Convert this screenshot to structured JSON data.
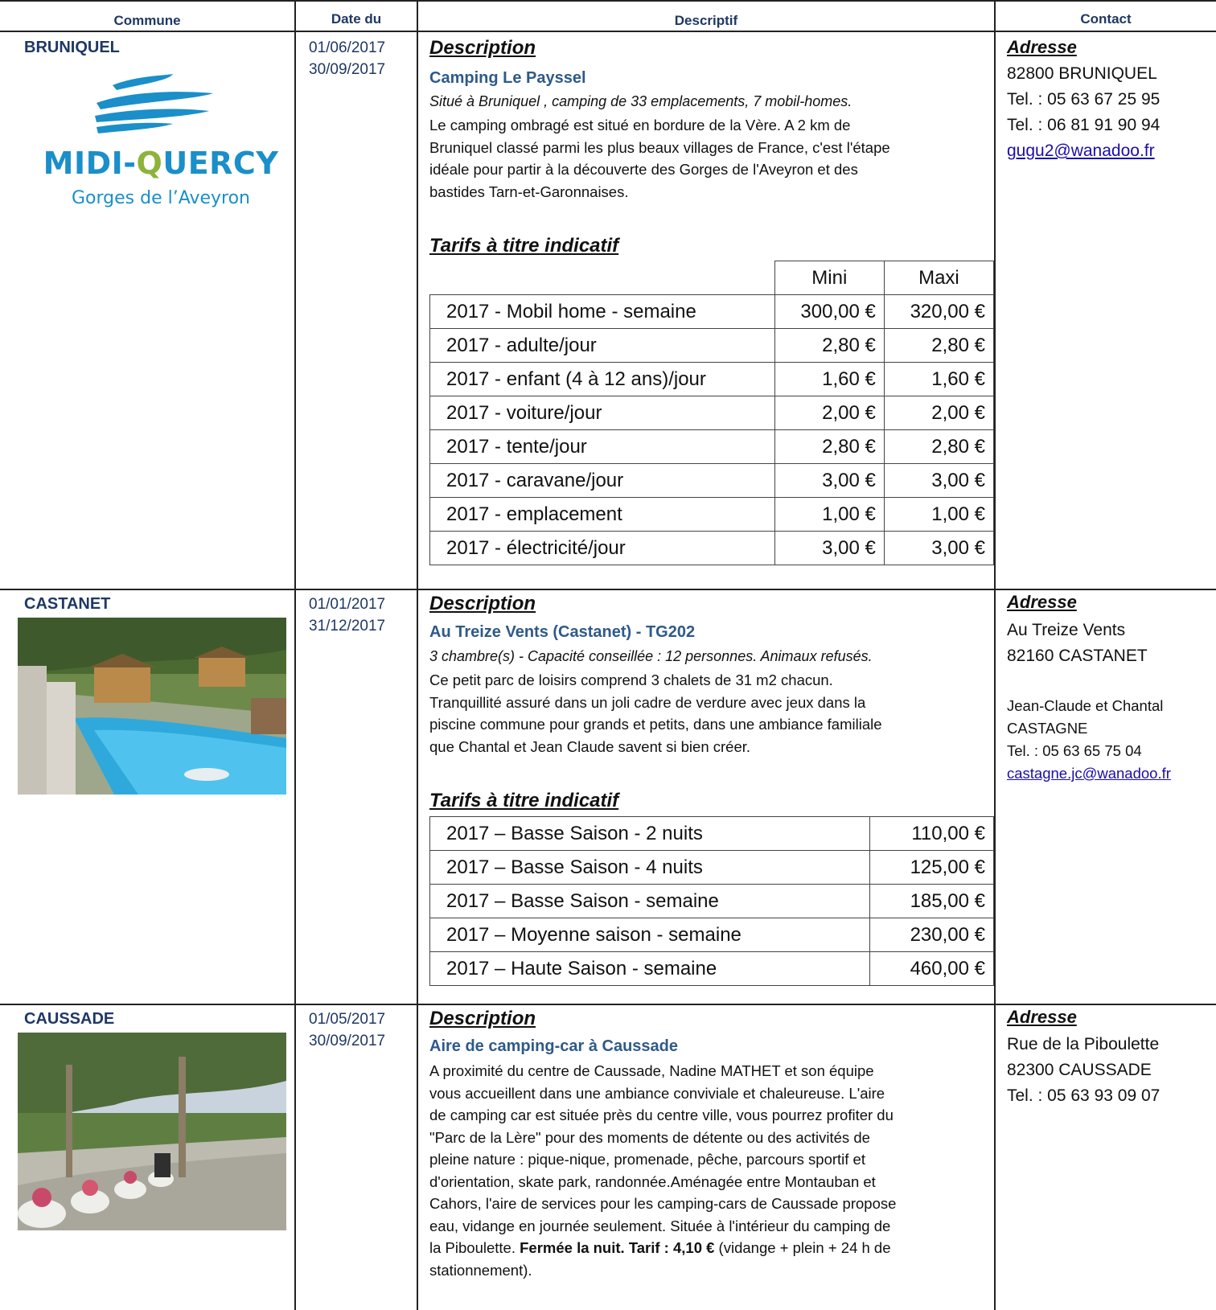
{
  "headers": {
    "commune": "Commune",
    "date": "Date du",
    "descriptif": "Descriptif",
    "contact": "Contact"
  },
  "rows": [
    {
      "commune": "BRUNIQUEL",
      "logo": {
        "line1": "MIDI-QUERCY",
        "line2": "Gorges de l’Aveyron",
        "q_color": "#8db33a",
        "brand_color": "#1a8fc9"
      },
      "dates": [
        "01/06/2017",
        "30/09/2017"
      ],
      "desc_heading": "Description",
      "name": "Camping Le Payssel",
      "italic": "Situé à Bruniquel , camping de 33 emplacements,  7 mobil-homes.",
      "lines": [
        "Le camping ombragé est situé en bordure de la Vère. A 2 km de",
        "Bruniquel classé parmi les plus beaux villages de France, c'est l'étape",
        "idéale pour partir à la découverte des Gorges de l'Aveyron et des",
        "bastides Tarn-et-Garonnaises."
      ],
      "tarifs_heading": "Tarifs à titre indicatif",
      "cols": [
        "Mini",
        "Maxi"
      ],
      "prices": [
        [
          "2017 - Mobil home - semaine",
          "300,00 €",
          "320,00 €"
        ],
        [
          "2017 - adulte/jour",
          "2,80 €",
          "2,80 €"
        ],
        [
          "2017 - enfant (4 à 12 ans)/jour",
          "1,60 €",
          "1,60 €"
        ],
        [
          "2017 - voiture/jour",
          "2,00 €",
          "2,00 €"
        ],
        [
          "2017 - tente/jour",
          "2,80 €",
          "2,80 €"
        ],
        [
          "2017 - caravane/jour",
          "3,00 €",
          "3,00 €"
        ],
        [
          "2017 - emplacement",
          "1,00 €",
          "1,00 €"
        ],
        [
          "2017 - électricité/jour",
          "3,00 €",
          "3,00 €"
        ]
      ],
      "contact_heading": "Adresse",
      "contact": [
        "82800 BRUNIQUEL",
        "Tel. : 05 63 67 25 95",
        "Tel. : 06 81 91 90 94"
      ],
      "email": "gugu2@wanadoo.fr"
    },
    {
      "commune": "CASTANET",
      "dates": [
        "01/01/2017",
        "31/12/2017"
      ],
      "desc_heading": "Description",
      "name": "Au Treize Vents (Castanet) - TG202",
      "italic": "3 chambre(s) - Capacité conseillée : 12 personnes.  Animaux refusés.",
      "lines": [
        "Ce petit parc de loisirs comprend 3 chalets de 31 m2 chacun.",
        "Tranquillité assuré dans un joli cadre de verdure avec jeux dans la",
        "piscine commune pour grands et petits, dans une ambiance familiale",
        "que Chantal et Jean Claude savent si bien créer."
      ],
      "tarifs_heading": "Tarifs à titre indicatif",
      "prices": [
        [
          "2017 – Basse Saison - 2 nuits",
          "110,00 €"
        ],
        [
          "2017 – Basse Saison - 4 nuits",
          "125,00 €"
        ],
        [
          "2017 – Basse Saison - semaine",
          "185,00 €"
        ],
        [
          "2017 – Moyenne saison - semaine",
          "230,00 €"
        ],
        [
          "2017 – Haute Saison - semaine",
          "460,00 €"
        ]
      ],
      "contact_heading": "Adresse",
      "contact": [
        "Au Treize Vents",
        "82160 CASTANET"
      ],
      "contact_small": [
        "Jean-Claude et Chantal",
        "CASTAGNE",
        "Tel. : 05 63 65 75 04"
      ],
      "email": "castagne.jc@wanadoo.fr"
    },
    {
      "commune": "CAUSSADE",
      "dates": [
        "01/05/2017",
        "30/09/2017"
      ],
      "desc_heading": "Description",
      "name": "Aire de camping-car à Caussade",
      "lines": [
        "A proximité du centre de Caussade, Nadine MATHET et son équipe",
        "vous accueillent dans une ambiance conviviale et chaleureuse. L'aire",
        "de camping car est située près du centre ville, vous pourrez profiter du",
        "\"Parc de la Lère\" pour des moments de détente ou des activités de",
        "pleine nature : pique-nique, promenade, pêche, parcours sportif et",
        "d'orientation, skate park, randonnée.Aménagée entre Montauban et",
        "Cahors, l'aire de services pour les camping-cars de Caussade propose",
        "eau, vidange en journée seulement. Située à l'intérieur du camping de"
      ],
      "last_line_pre": "la Piboulette. ",
      "last_line_bold": "Fermée la nuit. Tarif : 4,10 €",
      "last_line_post": " (vidange + plein + 24 h de",
      "final_line": "stationnement).",
      "contact_heading": "Adresse",
      "contact": [
        "Rue de la Piboulette",
        "82300 CAUSSADE",
        "Tel. : 05 63 93 09 07"
      ]
    }
  ]
}
